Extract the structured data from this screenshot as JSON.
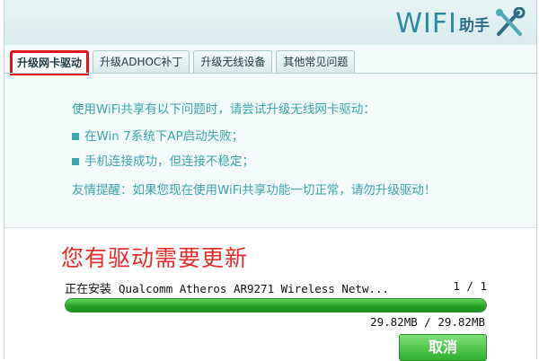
{
  "logo": {
    "wifi_text": "WIFI",
    "zh_text": "助手",
    "tools_icon": "tools-icon"
  },
  "tabs": [
    {
      "label": "升级网卡驱动",
      "active": true
    },
    {
      "label": "升级ADHOC补丁",
      "active": false
    },
    {
      "label": "升级无线设备",
      "active": false
    },
    {
      "label": "其他常见问题",
      "active": false
    }
  ],
  "info": {
    "intro": "使用WiFi共享有以下问题时，请尝试升级无线网卡驱动：",
    "items": [
      "在Win 7系统下AP启动失败；",
      "手机连接成功，但连接不稳定；"
    ],
    "tip": "友情提醒：如果您现在使用WiFi共享功能一切正常，请勿升级驱动！"
  },
  "update": {
    "title": "您有驱动需要更新",
    "installing_label": "正在安装",
    "driver_name": "Qualcomm Atheros AR9271 Wireless Netw...",
    "count": "1 / 1",
    "progress": 1.0,
    "size_text": "29.82MB / 29.82MB",
    "cancel_label": "取消"
  },
  "colors": {
    "accent": "#3aa6ad",
    "title_red": "#e52c2c",
    "progress_green": "#29a329",
    "tab_highlight": "#e3151a"
  }
}
